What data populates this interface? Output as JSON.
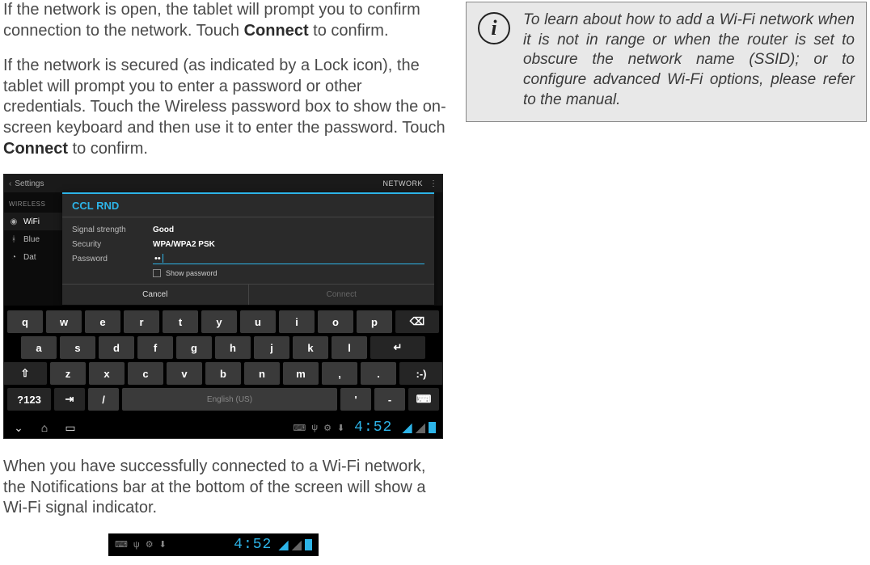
{
  "body": {
    "p1_pre": "If the network is open, the tablet will prompt you to confirm connection to the network. Touch ",
    "p1_bold": "Connect",
    "p1_post": " to confirm.",
    "p2_pre": "If the network is secured (as indicated by a Lock icon), the tablet will prompt you to enter a password or other credentials.  Touch the Wireless password box to show the on-screen keyboard and then use it to enter the password. Touch ",
    "p2_bold": "Connect",
    "p2_post": " to confirm.",
    "p3": "When you have successfully connected to a Wi-Fi network, the Notifications bar at the bottom of the screen will show a Wi-Fi signal indicator."
  },
  "info": {
    "text": "To learn about how to add a Wi-Fi network when it is not in range or when the router is set to obscure the network name (SSID); or to configure advanced Wi-Fi options, please refer to the manual."
  },
  "shot": {
    "titlebar": {
      "settings": "Settings",
      "network": "NETWORK",
      "menu": "⋮"
    },
    "sidebar": {
      "section": "WIRELESS",
      "items": [
        {
          "icon": "wifi",
          "label": "WiFi"
        },
        {
          "icon": "bt",
          "label": "Blue"
        },
        {
          "icon": "data",
          "label": "Dat"
        }
      ]
    },
    "dialog": {
      "title": "CCL RND",
      "rows": {
        "signal_label": "Signal strength",
        "signal_val": "Good",
        "security_label": "Security",
        "security_val": "WPA/WPA2 PSK",
        "password_label": "Password",
        "password_val": "••"
      },
      "show_password": "Show password",
      "cancel": "Cancel",
      "connect": "Connect"
    },
    "keyboard": {
      "row1": [
        "q",
        "w",
        "e",
        "r",
        "t",
        "y",
        "u",
        "i",
        "o",
        "p"
      ],
      "row2": [
        "a",
        "s",
        "d",
        "f",
        "g",
        "h",
        "j",
        "k",
        "l"
      ],
      "row3": [
        "z",
        "x",
        "c",
        "v",
        "b",
        "n",
        "m",
        ",",
        "."
      ],
      "shift": "⇧",
      "backspace": "⌫",
      "enter": "↵",
      "smiley": ":-)",
      "sym": "?123",
      "tab": "⇥",
      "slash": "/",
      "space": "English (US)",
      "apos": "'",
      "dash": "-",
      "mic": "⌨"
    },
    "navbar": {
      "back": "⌄",
      "home": "⌂",
      "recent": "▭",
      "clock": "4:52"
    }
  },
  "statusbar_small": {
    "clock": "4:52"
  }
}
